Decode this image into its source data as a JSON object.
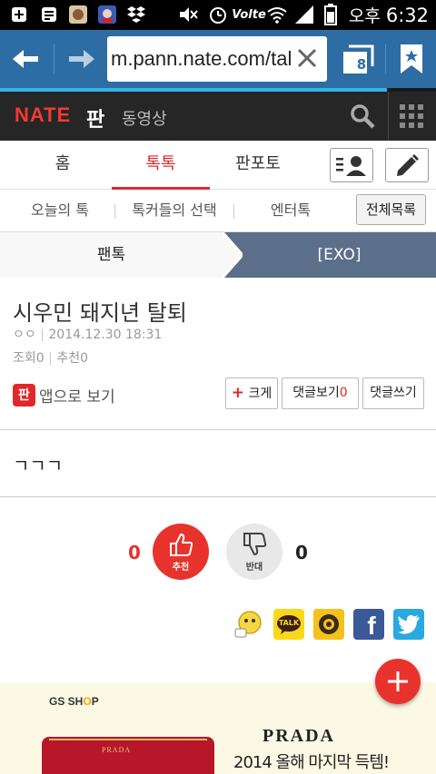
{
  "status_bar": {
    "ampm": "오후",
    "time": "6:32",
    "icons": [
      "plus-icon",
      "clipboard-icon",
      "app-icon",
      "app-icon",
      "dropbox-icon",
      "mute-icon",
      "alarm-icon",
      "volte-icon",
      "wifi-icon",
      "signal-icon",
      "battery-icon"
    ],
    "volte_label": "Volte"
  },
  "browser": {
    "url": "m.pann.nate.com/tal",
    "tab_count": "8",
    "accent_color": "#2e6da4"
  },
  "site_header": {
    "logo": "NATE",
    "section": "판",
    "video_link": "동영상",
    "accent_color": "#f33b2f"
  },
  "tabs": {
    "items": [
      "홈",
      "톡톡",
      "판포토"
    ],
    "active": "톡톡"
  },
  "subtabs": {
    "items": [
      "오늘의 톡",
      "톡커들의 선택",
      "엔터톡"
    ],
    "all_list": "전체목록"
  },
  "breadcrumb": {
    "parent": "팬톡",
    "current": "[EXO]"
  },
  "article": {
    "title": "시우민 돼지년 탈퇴",
    "author": "ㅇㅇ",
    "datetime": "2014.12.30 18:31",
    "views_label": "조회",
    "views": "0",
    "recommend_label": "추천",
    "recommend": "0",
    "app_badge": "판",
    "app_view": "앱으로 보기",
    "font_size_plus": "+",
    "font_size_label": "크게",
    "view_comments_label": "댓글보기",
    "comment_count": "0",
    "write_comment_label": "댓글쓰기",
    "body": "ㄱㄱㄱ"
  },
  "votes": {
    "up_count": "0",
    "up_label": "추천",
    "down_count": "0",
    "down_label": "반대",
    "up_color": "#e8332d"
  },
  "share": {
    "kakao_label": "TALK",
    "facebook_glyph": "f"
  },
  "ad": {
    "shop": "GS SHOP",
    "shop_part1": "GS SH",
    "shop_o": "O",
    "shop_part2": "P",
    "brand": "PRADA",
    "promo": "2014 올해 마지막 득템!",
    "bag_logo": "PRADA"
  }
}
